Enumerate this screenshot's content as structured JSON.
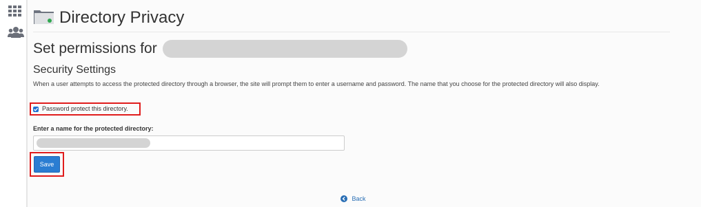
{
  "sidebar": {
    "icons": [
      {
        "name": "apps-grid-icon"
      },
      {
        "name": "users-icon"
      }
    ]
  },
  "header": {
    "icon": "folder-icon",
    "title": "Directory Privacy"
  },
  "permissions": {
    "heading": "Set permissions for",
    "path_redacted": true
  },
  "security": {
    "title": "Security Settings",
    "description": "When a user attempts to access the protected directory through a browser, the site will prompt them to enter a username and password. The name that you choose for the protected directory will also display.",
    "protect_checkbox": {
      "label": "Password protect this directory.",
      "checked": true
    },
    "name_field": {
      "label": "Enter a name for the protected directory:",
      "value_redacted": true
    },
    "save_label": "Save"
  },
  "footer": {
    "back_label": "Back",
    "back_icon": "arrow-left-circle-icon"
  },
  "colors": {
    "accent": "#2a7dd2",
    "highlight": "#e01b1b",
    "link": "#2a6fb5",
    "redaction": "#d4d4d4"
  }
}
